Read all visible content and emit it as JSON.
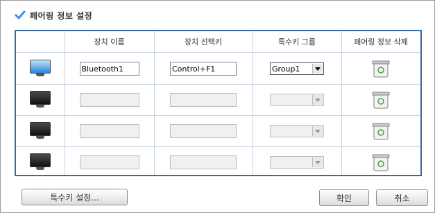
{
  "dialog": {
    "title": "페어링 정보 설정",
    "icons": {
      "title": "checkmark-icon",
      "device_active": "monitor-blue-icon",
      "device_inactive": "monitor-dark-icon",
      "delete": "trash-can-icon",
      "dropdown": "chevron-down-icon"
    }
  },
  "table": {
    "headers": {
      "device_name": "장치 이름",
      "device_select_key": "장치 선택키",
      "special_key_group": "특수키 그룹",
      "delete_pairing": "페어링 정보 삭제"
    },
    "rows": [
      {
        "device_name": "Bluetooth1",
        "select_key": "Control+F1",
        "group": "Group1",
        "enabled": true
      },
      {
        "device_name": "",
        "select_key": "",
        "group": "",
        "enabled": false
      },
      {
        "device_name": "",
        "select_key": "",
        "group": "",
        "enabled": false
      },
      {
        "device_name": "",
        "select_key": "",
        "group": "",
        "enabled": false
      }
    ]
  },
  "buttons": {
    "special_key_settings": "특수키 설정...",
    "ok": "확인",
    "cancel": "취소"
  },
  "colors": {
    "table_border": "#3b6aa0",
    "grid_line": "#c7d3e3",
    "check_accent": "#3a8ee6"
  }
}
